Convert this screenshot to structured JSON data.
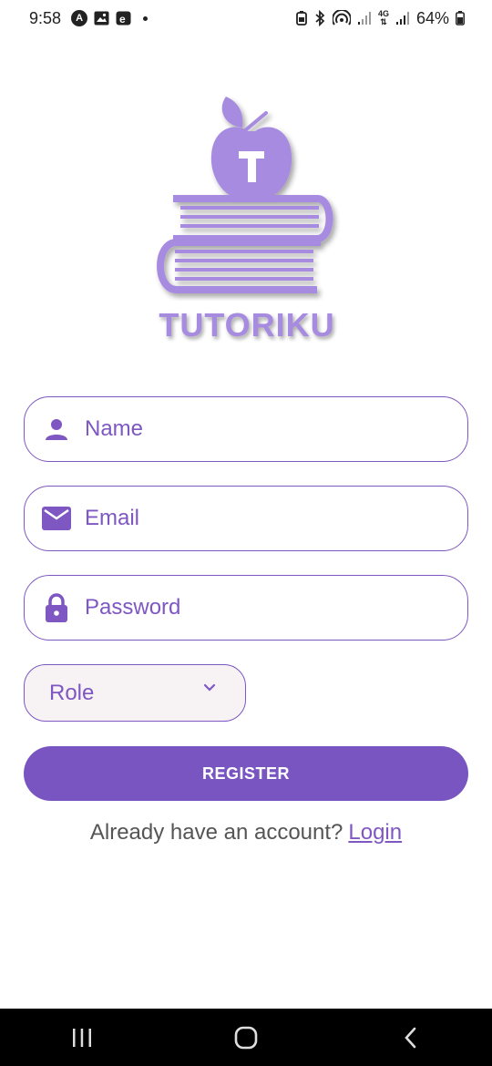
{
  "status_bar": {
    "time": "9:58",
    "battery_percent": "64%",
    "network_label": "4G"
  },
  "logo": {
    "brand_name": "TUTORIKU",
    "emblem_letter": "T"
  },
  "form": {
    "name_placeholder": "Name",
    "email_placeholder": "Email",
    "password_placeholder": "Password",
    "role_selected": "Role",
    "register_label": "REGISTER"
  },
  "footer": {
    "prompt_text": "Already have an account?",
    "login_link": "Login"
  },
  "colors": {
    "accent": "#7e57c2",
    "button": "#7955c1",
    "logo": "#a78be0",
    "role_bg": "#f7f2f3"
  },
  "icons": [
    "person-icon",
    "envelope-icon",
    "lock-icon",
    "chevron-down-icon",
    "recents-icon",
    "home-icon",
    "back-icon"
  ]
}
